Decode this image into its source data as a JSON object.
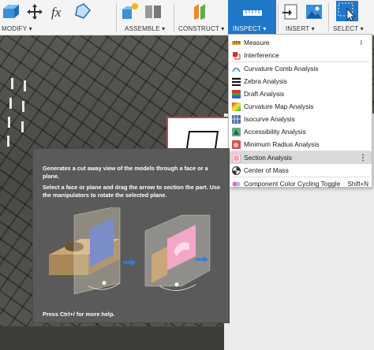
{
  "toolbar": {
    "groups": [
      {
        "label": "MODIFY ▾"
      },
      {
        "label": "ASSEMBLE ▾"
      },
      {
        "label": "CONSTRUCT ▾"
      },
      {
        "label": "INSPECT ▾"
      },
      {
        "label": "INSERT ▾"
      },
      {
        "label": "SELECT ▾"
      }
    ],
    "icons": {
      "modify": [
        "press-pull-icon",
        "move-icon",
        "fx-parameters-icon",
        "shell-icon"
      ],
      "assemble": [
        "new-component-icon",
        "joint-icon"
      ],
      "construct": [
        "offset-plane-icon"
      ],
      "inspect": [
        "measure-icon"
      ],
      "insert": [
        "insert-derive-icon",
        "insert-image-icon"
      ],
      "select": [
        "select-cursor-icon"
      ]
    },
    "accent_color": "#1f78c8"
  },
  "inspect_menu": {
    "items": [
      {
        "label": "Measure",
        "shortcut": "I",
        "icon": "ruler-icon"
      },
      {
        "label": "Interference",
        "icon": "interference-icon"
      },
      {
        "label": "Curvature Comb Analysis",
        "icon": "curvature-comb-icon"
      },
      {
        "label": "Zebra Analysis",
        "icon": "zebra-icon"
      },
      {
        "label": "Draft Analysis",
        "icon": "draft-icon"
      },
      {
        "label": "Curvature Map Analysis",
        "icon": "curvature-map-icon"
      },
      {
        "label": "Isocurve Analysis",
        "icon": "isocurve-icon"
      },
      {
        "label": "Accessibility Analysis",
        "icon": "accessibility-icon"
      },
      {
        "label": "Minimum Radius Analysis",
        "icon": "minimum-radius-icon"
      },
      {
        "label": "Section Analysis",
        "icon": "section-analysis-icon"
      },
      {
        "label": "Center of Mass",
        "icon": "center-of-mass-icon"
      },
      {
        "label": "Component Color Cycling Toggle",
        "shortcut": "Shift+N",
        "icon": "color-cycling-icon"
      }
    ],
    "more_glyph": "⋮"
  },
  "tooltip": {
    "line1": "Generates a cut away view of the models through a face or a plane.",
    "line2": "Select a face or plane and drag the arrow to section the part. Use the manipulators to rotate the selected plane.",
    "footer": "Press Ctrl+/ for more help."
  }
}
